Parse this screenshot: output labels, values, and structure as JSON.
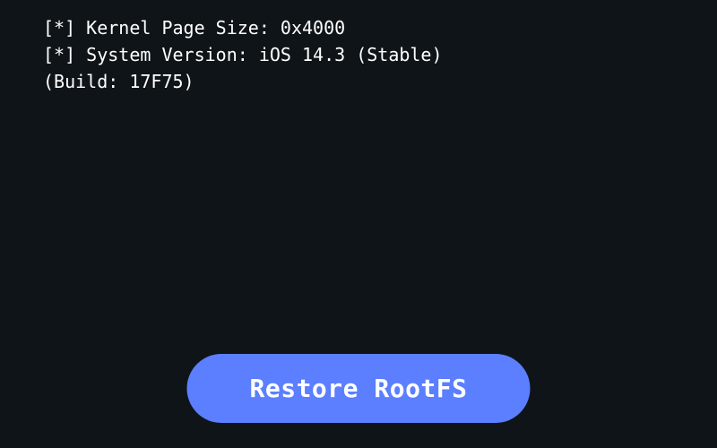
{
  "log": {
    "lines": [
      "[*] Kernel Page Size: 0x4000",
      "[*] System Version: iOS 14.3 (Stable)",
      "(Build: 17F75)"
    ]
  },
  "button": {
    "restore_label": "Restore RootFS"
  },
  "colors": {
    "background": "#0f1419",
    "text": "#ffffff",
    "button_bg": "#5b7fff"
  }
}
